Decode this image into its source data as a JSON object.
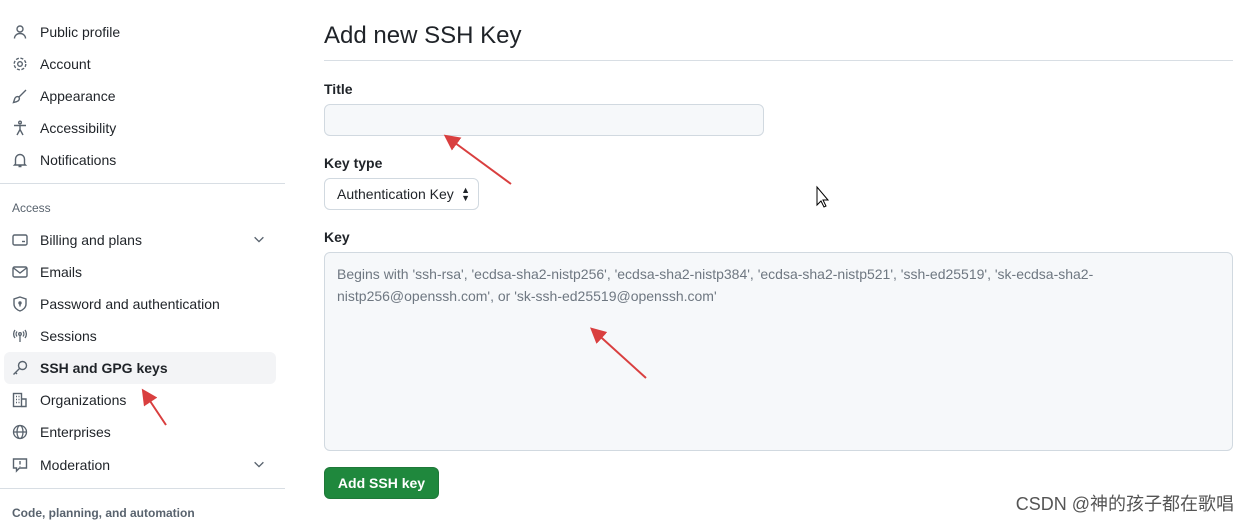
{
  "sidebar": {
    "items": [
      {
        "label": "Public profile",
        "icon": "person-icon"
      },
      {
        "label": "Account",
        "icon": "gear-icon"
      },
      {
        "label": "Appearance",
        "icon": "paintbrush-icon"
      },
      {
        "label": "Accessibility",
        "icon": "accessibility-icon"
      },
      {
        "label": "Notifications",
        "icon": "bell-icon"
      }
    ],
    "access_heading": "Access",
    "access_items": [
      {
        "label": "Billing and plans",
        "icon": "credit-card-icon"
      },
      {
        "label": "Emails",
        "icon": "mail-icon"
      },
      {
        "label": "Password and authentication",
        "icon": "shield-lock-icon"
      },
      {
        "label": "Sessions",
        "icon": "broadcast-icon"
      },
      {
        "label": "SSH and GPG keys",
        "icon": "key-icon",
        "active": true
      },
      {
        "label": "Organizations",
        "icon": "organization-icon"
      },
      {
        "label": "Enterprises",
        "icon": "globe-icon"
      },
      {
        "label": "Moderation",
        "icon": "report-icon"
      }
    ],
    "code_heading": "Code, planning, and automation"
  },
  "main": {
    "title": "Add new SSH Key",
    "title_label": "Title",
    "title_value": "",
    "key_type_label": "Key type",
    "key_type_value": "Authentication Key",
    "key_label": "Key",
    "key_placeholder": "Begins with 'ssh-rsa', 'ecdsa-sha2-nistp256', 'ecdsa-sha2-nistp384', 'ecdsa-sha2-nistp521', 'ssh-ed25519', 'sk-ecdsa-sha2-nistp256@openssh.com', or 'sk-ssh-ed25519@openssh.com'",
    "submit_label": "Add SSH key"
  },
  "watermark": "CSDN @神的孩子都在歌唱",
  "colors": {
    "primary_button": "#1f883d",
    "annotation_arrow": "#d93f3f"
  }
}
